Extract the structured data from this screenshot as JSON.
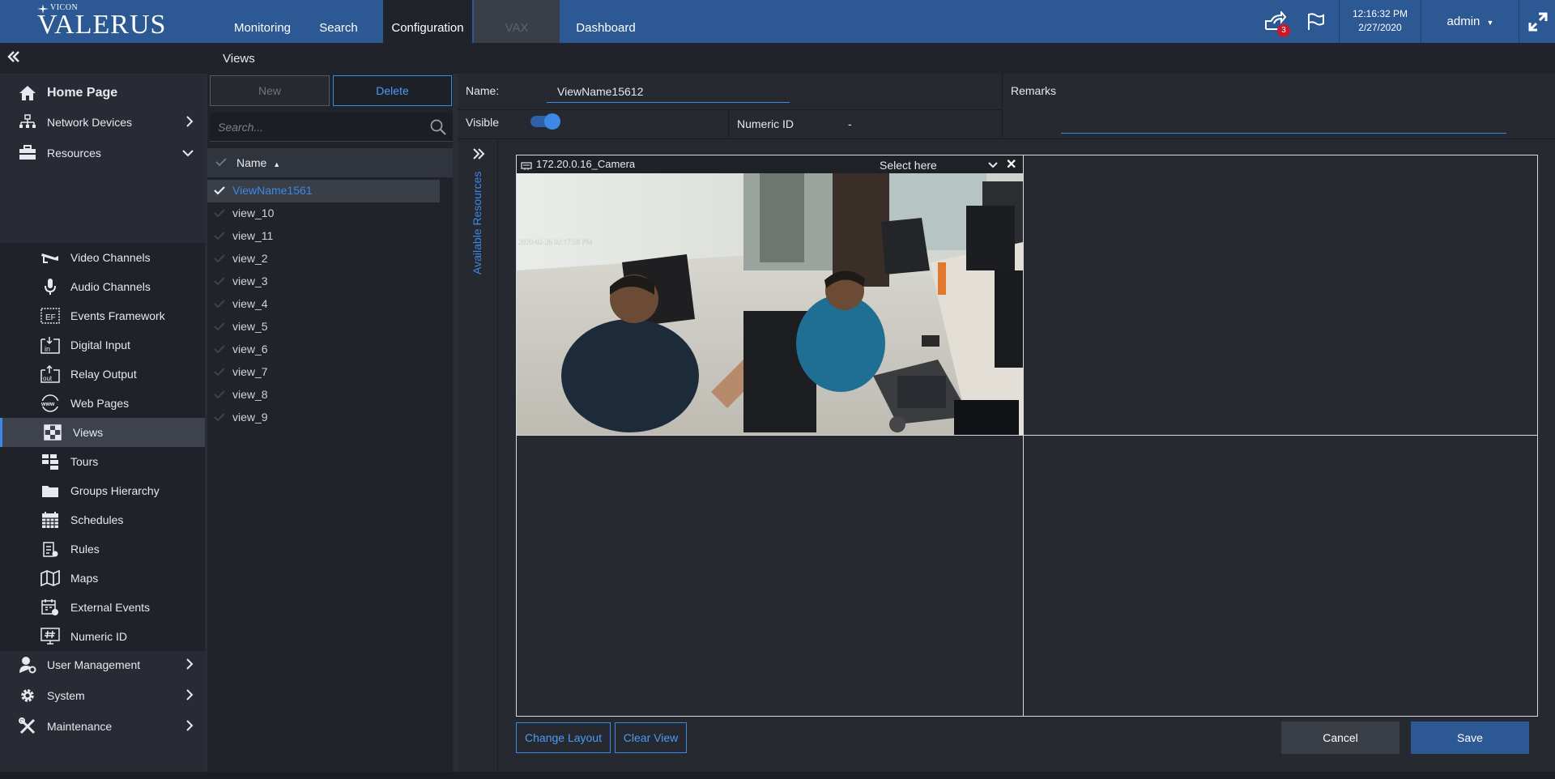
{
  "app": {
    "brand_small": "VICON",
    "brand_name": "VALERUS"
  },
  "nav": {
    "tabs": [
      {
        "label": "Monitoring"
      },
      {
        "label": "Search"
      },
      {
        "label": "Configuration"
      },
      {
        "label": "VAX"
      },
      {
        "label": "Dashboard"
      }
    ],
    "active_tab": "Configuration",
    "notifications_count": "3",
    "time": "12:16:32 PM",
    "date": "2/27/2020",
    "user": "admin"
  },
  "breadcrumb": "Views",
  "sidebar": {
    "items": [
      {
        "label": "Home Page",
        "icon": "home-icon"
      },
      {
        "label": "Network Devices",
        "icon": "network-icon"
      },
      {
        "label": "Resources",
        "icon": "toolbox-icon"
      },
      {
        "label": "Video Channels",
        "icon": "camera-icon"
      },
      {
        "label": "Audio Channels",
        "icon": "microphone-icon"
      },
      {
        "label": "Events Framework",
        "icon": "events-framework-icon"
      },
      {
        "label": "Digital Input",
        "icon": "digital-input-icon"
      },
      {
        "label": "Relay Output",
        "icon": "relay-output-icon"
      },
      {
        "label": "Web Pages",
        "icon": "www-icon"
      },
      {
        "label": "Views",
        "icon": "views-icon"
      },
      {
        "label": "Tours",
        "icon": "tours-icon"
      },
      {
        "label": "Groups Hierarchy",
        "icon": "folder-icon"
      },
      {
        "label": "Schedules",
        "icon": "calendar-icon"
      },
      {
        "label": "Rules",
        "icon": "rules-icon"
      },
      {
        "label": "Maps",
        "icon": "map-icon"
      },
      {
        "label": "External Events",
        "icon": "external-events-icon"
      },
      {
        "label": "Numeric ID",
        "icon": "numeric-id-icon"
      },
      {
        "label": "User Management",
        "icon": "user-management-icon"
      },
      {
        "label": "System",
        "icon": "gear-icon"
      },
      {
        "label": "Maintenance",
        "icon": "tools-icon"
      }
    ]
  },
  "list": {
    "new_label": "New",
    "delete_label": "Delete",
    "search_placeholder": "Search...",
    "column_header": "Name",
    "rows": [
      "ViewName1561",
      "view_10",
      "view_11",
      "view_2",
      "view_3",
      "view_4",
      "view_5",
      "view_6",
      "view_7",
      "view_8",
      "view_9"
    ]
  },
  "form": {
    "name_label": "Name:",
    "name_value": "ViewName15612",
    "visible_label": "Visible",
    "visible": true,
    "numeric_id_label": "Numeric ID",
    "numeric_id_value": "-",
    "remarks_label": "Remarks",
    "available_resources_label": "Available Resources"
  },
  "layout": {
    "camera_label": "172.20.0.16_Camera",
    "select_label": "Select here",
    "osd_timestamp": "2020-02-26 02:17:58 PM",
    "change_layout_label": "Change Layout",
    "clear_view_label": "Clear View",
    "cancel_label": "Cancel",
    "save_label": "Save"
  },
  "colors": {
    "accent": "#3b88e6",
    "topbar": "#2c5893",
    "badge": "#c8192a"
  }
}
